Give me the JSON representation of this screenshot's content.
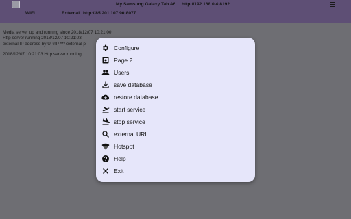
{
  "header": {
    "title": "My Samsung Galaxy Tab A6",
    "local_url": "http://192.168.0.4:8192",
    "wifi_label": "WiFi",
    "external_label": "External",
    "external_url": "http://85.201.107.90:8077"
  },
  "log": {
    "lines": [
      "Media server up and running since 2018/12/07 10:21:00",
      "Http server running 2018/12/07 10:21:03",
      "external IP address by UPnP *** external p",
      "2018/12/07 10:21:03 Http server running"
    ]
  },
  "menu": {
    "items": [
      {
        "label": "Configure",
        "icon": "gear-icon"
      },
      {
        "label": "Page 2",
        "icon": "page-icon"
      },
      {
        "label": "Users",
        "icon": "users-icon"
      },
      {
        "label": "save database",
        "icon": "download-icon"
      },
      {
        "label": "restore database",
        "icon": "cloud-download-icon"
      },
      {
        "label": "start service",
        "icon": "takeoff-icon"
      },
      {
        "label": "stop service",
        "icon": "landing-icon"
      },
      {
        "label": "external URL",
        "icon": "search-icon"
      },
      {
        "label": "Hotspot",
        "icon": "wifi-icon"
      },
      {
        "label": "Help",
        "icon": "help-icon"
      },
      {
        "label": "Exit",
        "icon": "close-icon"
      }
    ]
  },
  "colors": {
    "topbar": "#5e4f75",
    "background": "#6e6e73",
    "dialog": "#e6e6fa"
  }
}
